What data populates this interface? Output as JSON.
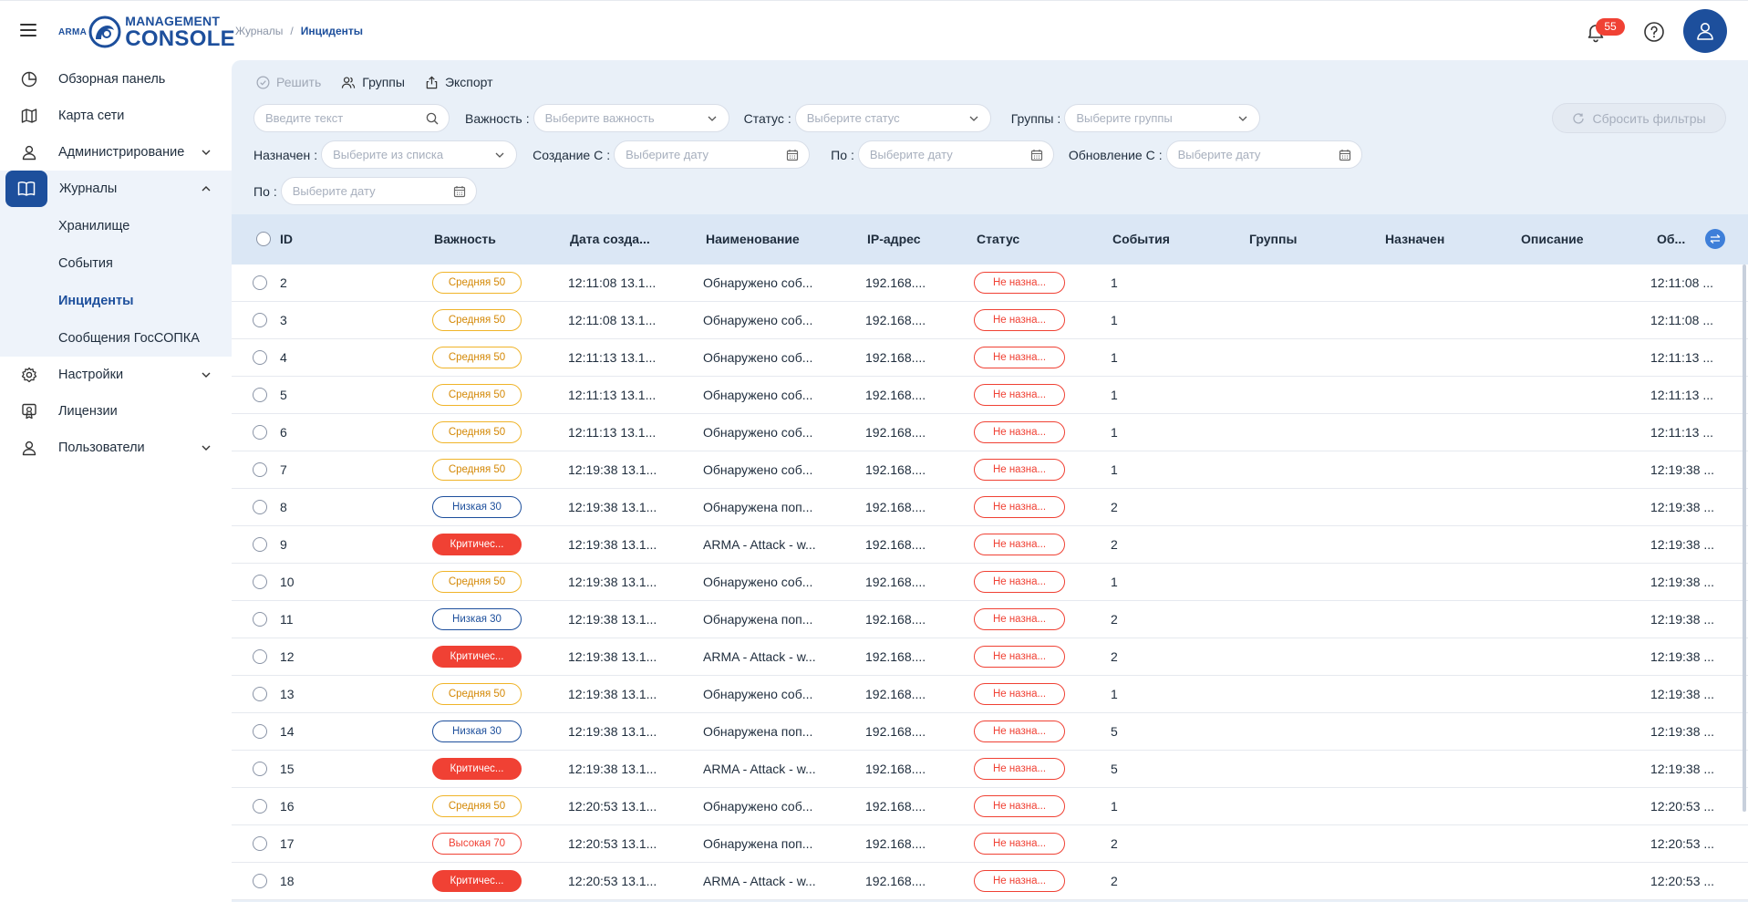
{
  "brand": {
    "small": "ARMA",
    "line1": "MANAGEMENT",
    "line2": "CONSOLE",
    "color": "#1d4f9c"
  },
  "breadcrumb": {
    "parent": "Журналы",
    "separator": "/",
    "current": "Инциденты"
  },
  "notifications": {
    "count": "55"
  },
  "sidebar": {
    "items": [
      {
        "label": "Обзорная панель",
        "icon": "pie-chart-icon"
      },
      {
        "label": "Карта сети",
        "icon": "map-icon"
      },
      {
        "label": "Администрирование",
        "icon": "user-icon"
      }
    ],
    "journals_label": "Журналы",
    "journals_sub": [
      "Хранилище",
      "События",
      "Инциденты",
      "Сообщения ГосСОПКА"
    ],
    "bottom_items": [
      {
        "label": "Настройки",
        "icon": "gear-icon"
      },
      {
        "label": "Лицензии",
        "icon": "license-icon"
      },
      {
        "label": "Пользователи",
        "icon": "user-icon"
      }
    ]
  },
  "toolbar": {
    "resolve": "Решить",
    "groups": "Группы",
    "export": "Экспорт"
  },
  "filters": {
    "search_placeholder": "Введите текст",
    "severity_label": "Важность",
    "severity_placeholder": "Выберите важность",
    "status_label": "Статус",
    "status_placeholder": "Выберите статус",
    "groups_label": "Группы",
    "groups_placeholder": "Выберите группы",
    "reset": "Сбросить фильтры",
    "assigned_label": "Назначен",
    "assigned_placeholder": "Выберите из списка",
    "created_from_label": "Создание С",
    "created_from_placeholder": "Выберите дату",
    "created_to_label": "По",
    "created_to_placeholder": "Выберите дату",
    "updated_from_label": "Обновление С",
    "updated_from_placeholder": "Выберите дату",
    "updated_to_label": "По",
    "updated_to_placeholder": "Выберите дату"
  },
  "table": {
    "headers": [
      "ID",
      "Важность",
      "Дата созда...",
      "Наименование",
      "IP-адрес",
      "Статус",
      "События",
      "Группы",
      "Назначен",
      "Описание",
      "Об..."
    ],
    "rows": [
      {
        "id": "2",
        "sev": "Средняя 50",
        "sev_type": "medium",
        "created": "12:11:08 13.1...",
        "name": "Обнаружено соб...",
        "ip": "192.168....",
        "status": "Не назна...",
        "events": "1",
        "updated": "12:11:08 ..."
      },
      {
        "id": "3",
        "sev": "Средняя 50",
        "sev_type": "medium",
        "created": "12:11:08 13.1...",
        "name": "Обнаружено соб...",
        "ip": "192.168....",
        "status": "Не назна...",
        "events": "1",
        "updated": "12:11:08 ..."
      },
      {
        "id": "4",
        "sev": "Средняя 50",
        "sev_type": "medium",
        "created": "12:11:13 13.1...",
        "name": "Обнаружено соб...",
        "ip": "192.168....",
        "status": "Не назна...",
        "events": "1",
        "updated": "12:11:13 ..."
      },
      {
        "id": "5",
        "sev": "Средняя 50",
        "sev_type": "medium",
        "created": "12:11:13 13.1...",
        "name": "Обнаружено соб...",
        "ip": "192.168....",
        "status": "Не назна...",
        "events": "1",
        "updated": "12:11:13 ..."
      },
      {
        "id": "6",
        "sev": "Средняя 50",
        "sev_type": "medium",
        "created": "12:11:13 13.1...",
        "name": "Обнаружено соб...",
        "ip": "192.168....",
        "status": "Не назна...",
        "events": "1",
        "updated": "12:11:13 ..."
      },
      {
        "id": "7",
        "sev": "Средняя 50",
        "sev_type": "medium",
        "created": "12:19:38 13.1...",
        "name": "Обнаружено соб...",
        "ip": "192.168....",
        "status": "Не назна...",
        "events": "1",
        "updated": "12:19:38 ..."
      },
      {
        "id": "8",
        "sev": "Низкая 30",
        "sev_type": "low",
        "created": "12:19:38 13.1...",
        "name": "Обнаружена поп...",
        "ip": "192.168....",
        "status": "Не назна...",
        "events": "2",
        "updated": "12:19:38 ..."
      },
      {
        "id": "9",
        "sev": "Критичес...",
        "sev_type": "critical",
        "created": "12:19:38 13.1...",
        "name": "ARMA - Attack - w...",
        "ip": "192.168....",
        "status": "Не назна...",
        "events": "2",
        "updated": "12:19:38 ..."
      },
      {
        "id": "10",
        "sev": "Средняя 50",
        "sev_type": "medium",
        "created": "12:19:38 13.1...",
        "name": "Обнаружено соб...",
        "ip": "192.168....",
        "status": "Не назна...",
        "events": "1",
        "updated": "12:19:38 ..."
      },
      {
        "id": "11",
        "sev": "Низкая 30",
        "sev_type": "low",
        "created": "12:19:38 13.1...",
        "name": "Обнаружена поп...",
        "ip": "192.168....",
        "status": "Не назна...",
        "events": "2",
        "updated": "12:19:38 ..."
      },
      {
        "id": "12",
        "sev": "Критичес...",
        "sev_type": "critical",
        "created": "12:19:38 13.1...",
        "name": "ARMA - Attack - w...",
        "ip": "192.168....",
        "status": "Не назна...",
        "events": "2",
        "updated": "12:19:38 ..."
      },
      {
        "id": "13",
        "sev": "Средняя 50",
        "sev_type": "medium",
        "created": "12:19:38 13.1...",
        "name": "Обнаружено соб...",
        "ip": "192.168....",
        "status": "Не назна...",
        "events": "1",
        "updated": "12:19:38 ..."
      },
      {
        "id": "14",
        "sev": "Низкая 30",
        "sev_type": "low",
        "created": "12:19:38 13.1...",
        "name": "Обнаружена поп...",
        "ip": "192.168....",
        "status": "Не назна...",
        "events": "5",
        "updated": "12:19:38 ..."
      },
      {
        "id": "15",
        "sev": "Критичес...",
        "sev_type": "critical",
        "created": "12:19:38 13.1...",
        "name": "ARMA - Attack - w...",
        "ip": "192.168....",
        "status": "Не назна...",
        "events": "5",
        "updated": "12:19:38 ..."
      },
      {
        "id": "16",
        "sev": "Средняя 50",
        "sev_type": "medium",
        "created": "12:20:53 13.1...",
        "name": "Обнаружено соб...",
        "ip": "192.168....",
        "status": "Не назна...",
        "events": "1",
        "updated": "12:20:53 ..."
      },
      {
        "id": "17",
        "sev": "Высокая 70",
        "sev_type": "high",
        "created": "12:20:53 13.1...",
        "name": "Обнаружена поп...",
        "ip": "192.168....",
        "status": "Не назна...",
        "events": "2",
        "updated": "12:20:53 ..."
      },
      {
        "id": "18",
        "sev": "Критичес...",
        "sev_type": "critical",
        "created": "12:20:53 13.1...",
        "name": "ARMA - Attack - w...",
        "ip": "192.168....",
        "status": "Не назна...",
        "events": "2",
        "updated": "12:20:53 ..."
      }
    ]
  },
  "colors": {
    "accent": "#1d4f9c",
    "danger": "#f04134",
    "warning": "#f0b429",
    "main_bg": "#e9f0f8",
    "header_bg": "#dbe7f5"
  }
}
